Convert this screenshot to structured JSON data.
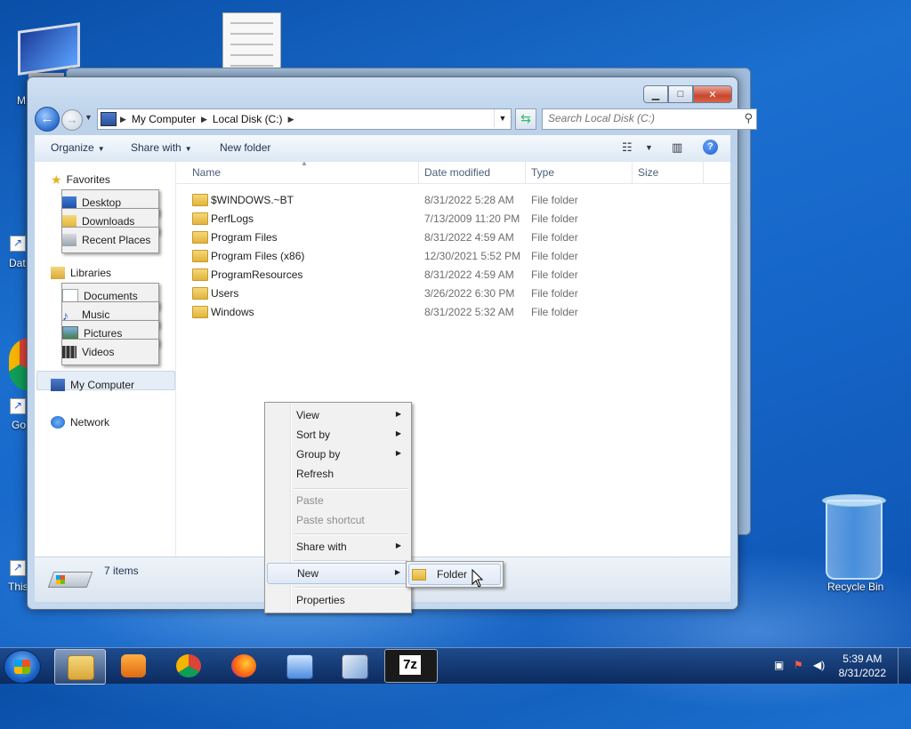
{
  "desktop": {
    "icons": [
      {
        "label": "M"
      },
      {
        "label": "Dat"
      },
      {
        "label": "Go"
      },
      {
        "label": "This"
      },
      {
        "label": "Recycle Bin"
      }
    ]
  },
  "window": {
    "nav": {
      "breadcrumb": [
        "My Computer",
        "Local Disk (C:)"
      ],
      "search_placeholder": "Search Local Disk (C:)"
    },
    "toolbar": {
      "organize": "Organize",
      "share_with": "Share with",
      "new_folder": "New folder"
    },
    "navpane": {
      "favorites": "Favorites",
      "favorites_items": [
        "Desktop",
        "Downloads",
        "Recent Places"
      ],
      "libraries": "Libraries",
      "libraries_items": [
        "Documents",
        "Music",
        "Pictures",
        "Videos"
      ],
      "computer": "My Computer",
      "network": "Network"
    },
    "columns": {
      "name": "Name",
      "date": "Date modified",
      "type": "Type",
      "size": "Size"
    },
    "rows": [
      {
        "name": "$WINDOWS.~BT",
        "date": "8/31/2022 5:28 AM",
        "type": "File folder"
      },
      {
        "name": "PerfLogs",
        "date": "7/13/2009 11:20 PM",
        "type": "File folder"
      },
      {
        "name": "Program Files",
        "date": "8/31/2022 4:59 AM",
        "type": "File folder"
      },
      {
        "name": "Program Files (x86)",
        "date": "12/30/2021 5:52 PM",
        "type": "File folder"
      },
      {
        "name": "ProgramResources",
        "date": "8/31/2022 4:59 AM",
        "type": "File folder"
      },
      {
        "name": "Users",
        "date": "3/26/2022 6:30 PM",
        "type": "File folder"
      },
      {
        "name": "Windows",
        "date": "8/31/2022 5:32 AM",
        "type": "File folder"
      }
    ],
    "status": {
      "count": "7 items"
    }
  },
  "context_menu": {
    "items": [
      {
        "label": "View"
      },
      {
        "label": "Sort by"
      },
      {
        "label": "Group by"
      },
      {
        "label": "Refresh"
      },
      {
        "label": "Paste"
      },
      {
        "label": "Paste shortcut"
      },
      {
        "label": "Share with"
      },
      {
        "label": "New"
      },
      {
        "label": "Properties"
      }
    ],
    "submenu": {
      "folder": "Folder"
    }
  },
  "taskbar": {
    "clock_time": "5:39 AM",
    "clock_date": "8/31/2022",
    "icons": [
      "start-icon",
      "explorer-icon",
      "media-player-icon",
      "chrome-icon",
      "firefox-icon",
      "control-panel-icon",
      "app-icon",
      "7zip-icon"
    ]
  },
  "colors": {
    "desktop_blue": "#1565c8",
    "close_red": "#c9452e",
    "selection": "#dfe9f6"
  }
}
